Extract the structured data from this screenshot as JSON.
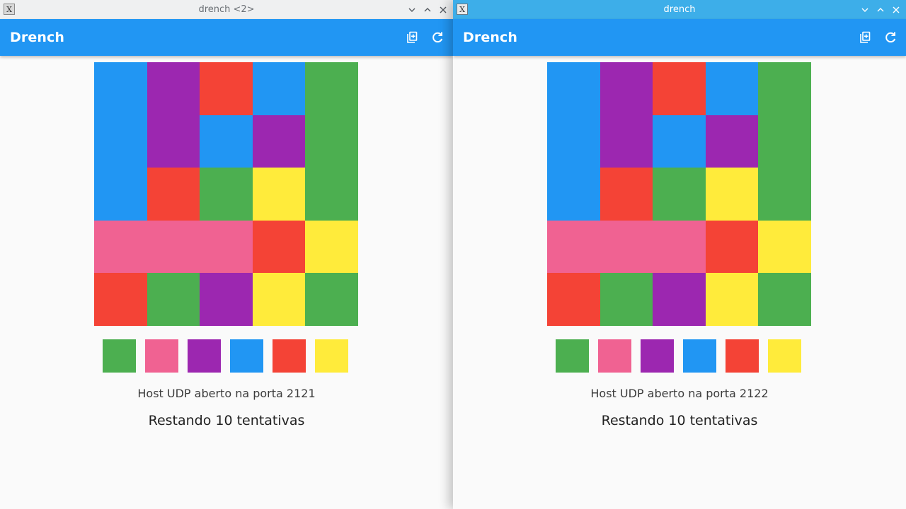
{
  "colors": {
    "blue": "#2196f3",
    "purple": "#9c27b0",
    "red": "#f44336",
    "green": "#4caf50",
    "yellow": "#ffeb3b",
    "pink": "#f06292"
  },
  "board": [
    [
      "blue",
      "purple",
      "red",
      "blue",
      "green"
    ],
    [
      "blue",
      "purple",
      "blue",
      "purple",
      "green"
    ],
    [
      "blue",
      "red",
      "green",
      "yellow",
      "green"
    ],
    [
      "pink",
      "pink",
      "pink",
      "red",
      "yellow"
    ],
    [
      "red",
      "green",
      "purple",
      "yellow",
      "green"
    ]
  ],
  "palette": [
    "green",
    "pink",
    "purple",
    "blue",
    "red",
    "yellow"
  ],
  "windows": [
    {
      "titlebar": "drench <2>",
      "app_title": "Drench",
      "host_text": "Host UDP aberto na porta 2121",
      "tries_text": "Restando 10 tentativas"
    },
    {
      "titlebar": "drench",
      "app_title": "Drench",
      "host_text": "Host UDP aberto na porta 2122",
      "tries_text": "Restando 10 tentativas"
    }
  ]
}
